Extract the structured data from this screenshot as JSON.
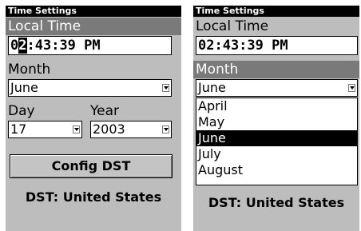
{
  "left_screen": {
    "title": "Time Settings",
    "local_time_label": "Local Time",
    "time_cursor_before": "0",
    "time_cursor_char": "2",
    "time_cursor_after": ":43:39 PM",
    "month_label": "Month",
    "month_value": "June",
    "day_label": "Day",
    "day_value": "17",
    "year_label": "Year",
    "year_value": "2003",
    "config_button": "Config DST",
    "dst_status": "DST: United States"
  },
  "right_screen": {
    "title": "Time Settings",
    "local_time_label": "Local Time",
    "time_value": "02:43:39 PM",
    "month_label": "Month",
    "month_value": "June",
    "month_options": [
      "April",
      "May",
      "June",
      "July",
      "August"
    ],
    "selected_option": "June",
    "dst_status": "DST: United States"
  },
  "colors": {
    "screen_bg": "#bdbdbd",
    "titlebar_bg": "#000000",
    "highlight_bg": "#7a7a7a",
    "field_bg": "#ffffff"
  }
}
